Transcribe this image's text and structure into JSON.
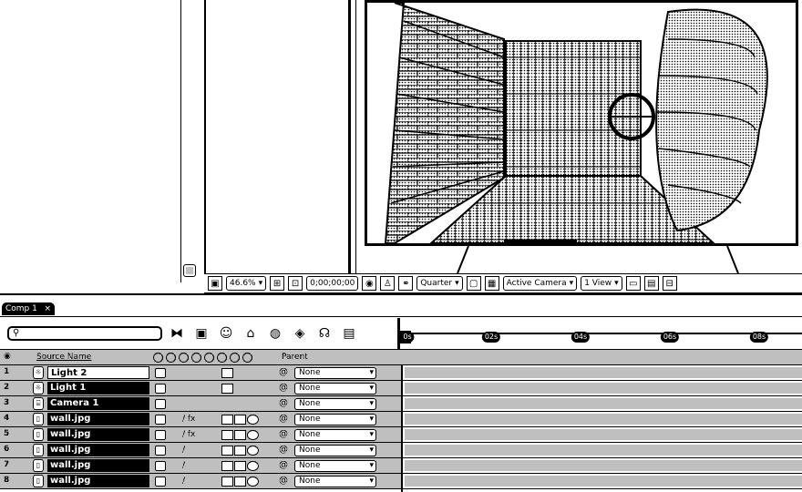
{
  "viewer_toolbar": {
    "magnification": "46.6%",
    "timecode": "0;00;00;00",
    "resolution": "Quarter",
    "camera_view": "Active Camera",
    "views": "1 View"
  },
  "timeline": {
    "tab_label": "Comp 1",
    "tab_close": "×",
    "search_placeholder": "",
    "columns": {
      "source_name": "Source Name",
      "parent": "Parent"
    },
    "ruler_ticks": [
      "0s",
      "02s",
      "04s",
      "06s",
      "08s"
    ],
    "layers": [
      {
        "num": "1",
        "name": "Light 2",
        "type": "light",
        "selected": true,
        "parent": "None",
        "fx": ""
      },
      {
        "num": "2",
        "name": "Light 1",
        "type": "light",
        "selected": false,
        "parent": "None",
        "fx": ""
      },
      {
        "num": "3",
        "name": "Camera 1",
        "type": "camera",
        "selected": false,
        "parent": "None",
        "fx": ""
      },
      {
        "num": "4",
        "name": "wall.jpg",
        "type": "footage",
        "selected": false,
        "parent": "None",
        "fx": "/ fx"
      },
      {
        "num": "5",
        "name": "wall.jpg",
        "type": "footage",
        "selected": false,
        "parent": "None",
        "fx": "/ fx"
      },
      {
        "num": "6",
        "name": "wall.jpg",
        "type": "footage",
        "selected": false,
        "parent": "None",
        "fx": "/"
      },
      {
        "num": "7",
        "name": "wall.jpg",
        "type": "footage",
        "selected": false,
        "parent": "None",
        "fx": "/"
      },
      {
        "num": "8",
        "name": "wall.jpg",
        "type": "footage",
        "selected": false,
        "parent": "None",
        "fx": "/"
      }
    ]
  },
  "icons": {
    "search": "search-icon",
    "comp_mini_flowchart": "flowchart-icon",
    "draft_3d": "draft-3d-icon",
    "shy": "shy-icon",
    "frame_blending": "frame-blending-icon",
    "motion_blur": "motion-blur-icon",
    "brainstorm": "brainstorm-icon",
    "graph_editor": "graph-editor-icon"
  }
}
